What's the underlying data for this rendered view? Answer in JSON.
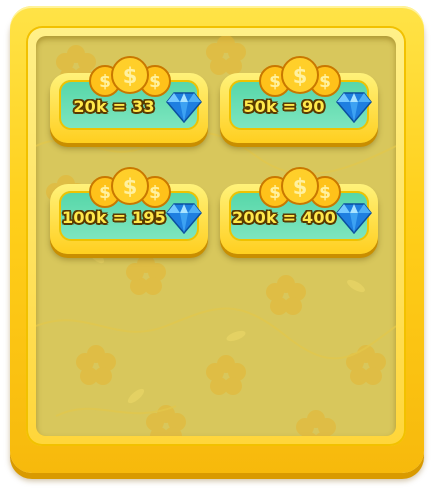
{
  "offers": [
    {
      "label": "20k = 33",
      "icon": "coin-stack-icon",
      "reward_icon": "diamond-icon"
    },
    {
      "label": "50k = 90",
      "icon": "coin-stack-icon",
      "reward_icon": "diamond-icon"
    },
    {
      "label": "100k = 195",
      "icon": "coin-stack-icon",
      "reward_icon": "diamond-icon"
    },
    {
      "label": "200k = 400",
      "icon": "coin-stack-icon",
      "reward_icon": "diamond-icon"
    }
  ],
  "colors": {
    "frame": "#ffd21f",
    "board": "#d8c75c",
    "card_inset": "#6ee0b6",
    "label_fill": "#ffe94a",
    "label_outline": "#5a3a00",
    "gem": "#2f9cf0"
  }
}
